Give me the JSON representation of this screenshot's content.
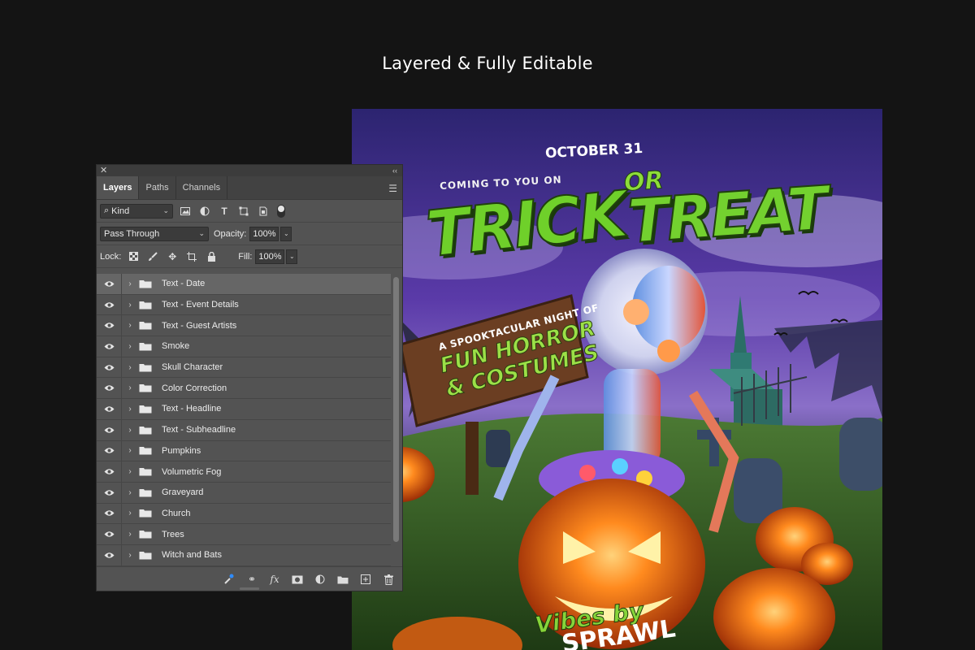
{
  "headline": "Layered & Fully Editable",
  "poster": {
    "coming": "COMING TO YOU ON",
    "date": "OCTOBER 31",
    "title_trick": "TRICK",
    "title_or": "OR",
    "title_treat": "TREAT",
    "sign_line1": "A SPOOKTACULAR NIGHT OF",
    "sign_line2": "FUN HORROR",
    "sign_line3": "& COSTUMES",
    "vibes": "Vibes by",
    "sprawl": "SPRAWL"
  },
  "panel": {
    "close_icon": "close-icon",
    "collapse_icon": "double-chevron-icon",
    "tabs": [
      {
        "label": "Layers",
        "active": true
      },
      {
        "label": "Paths",
        "active": false
      },
      {
        "label": "Channels",
        "active": false
      }
    ],
    "filter": {
      "label": "Kind"
    },
    "blend_mode": "Pass Through",
    "opacity_label": "Opacity:",
    "opacity_value": "100%",
    "lock_label": "Lock:",
    "fill_label": "Fill:",
    "fill_value": "100%",
    "layers": [
      {
        "name": "Text - Date",
        "selected": true
      },
      {
        "name": "Text - Event Details"
      },
      {
        "name": "Text - Guest Artists"
      },
      {
        "name": "Smoke"
      },
      {
        "name": "Skull Character"
      },
      {
        "name": "Color Correction"
      },
      {
        "name": "Text - Headline"
      },
      {
        "name": "Text - Subheadline"
      },
      {
        "name": "Pumpkins"
      },
      {
        "name": "Volumetric Fog"
      },
      {
        "name": "Graveyard"
      },
      {
        "name": "Church"
      },
      {
        "name": "Trees"
      },
      {
        "name": "Witch and Bats"
      }
    ],
    "bottom_fx": "fx"
  },
  "colors": {
    "background": "#141414",
    "panel": "#535353",
    "selected_row": "#666666",
    "poster_green": "#6fd02a",
    "pumpkin_orange": "#f07a1a"
  }
}
